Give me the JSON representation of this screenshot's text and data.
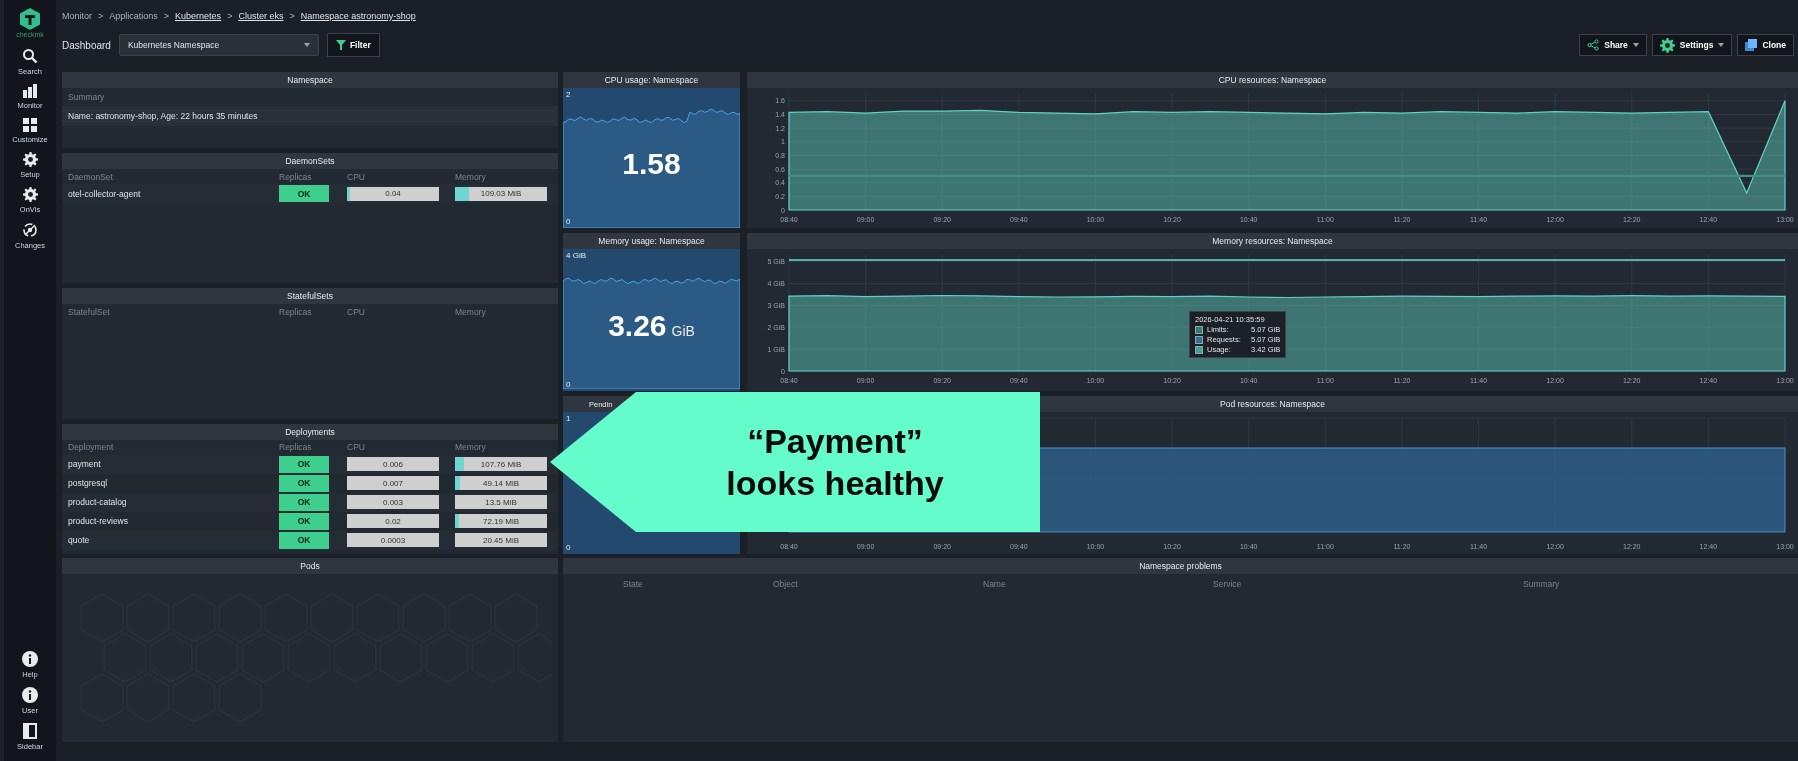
{
  "sidebar": {
    "logo_text": "checkmk",
    "items": [
      {
        "label": "Search",
        "kind": "search"
      },
      {
        "label": "Monitor",
        "kind": "bars"
      },
      {
        "label": "Customize",
        "kind": "grid"
      },
      {
        "label": "Setup",
        "kind": "gear"
      },
      {
        "label": "OnVis",
        "kind": "gear"
      },
      {
        "label": "Changes",
        "kind": "orbit"
      }
    ],
    "bottom_items": [
      {
        "label": "Help",
        "kind": "info"
      },
      {
        "label": "User",
        "kind": "info"
      },
      {
        "label": "Sidebar",
        "kind": "panel"
      }
    ]
  },
  "breadcrumb": {
    "separator": ">",
    "items": [
      {
        "label": "Monitor",
        "link": false
      },
      {
        "label": "Applications",
        "link": false
      },
      {
        "label": "Kubernetes",
        "link": true
      },
      {
        "label": "Cluster eks",
        "link": true
      },
      {
        "label": "Namespace astronomy-shop",
        "link": true
      }
    ]
  },
  "dashboard": {
    "label": "Dashboard",
    "select_value": "Kubernetes Namespace",
    "filter": "Filter"
  },
  "actions": [
    {
      "label": "Share",
      "kind": "share",
      "dropdown": true
    },
    {
      "label": "Settings",
      "kind": "gear",
      "dropdown": true
    },
    {
      "label": "Clone",
      "kind": "clone",
      "dropdown": false
    }
  ],
  "namespace": {
    "title": "Namespace",
    "summary_header": "Summary",
    "summary": "Name: astronomy-shop, Age: 22 hours 35 minutes"
  },
  "daemonsets": {
    "title": "DaemonSets",
    "columns": [
      "DaemonSet",
      "Replicas",
      "CPU",
      "Memory"
    ],
    "rows": [
      {
        "name": "otel-collector-agent",
        "replicas": "OK",
        "cpu": {
          "value": "0.04",
          "level": 0.03
        },
        "memory": {
          "value": "109.03 MiB",
          "level": 0.15
        }
      }
    ]
  },
  "statefulsets": {
    "title": "StatefulSets",
    "columns": [
      "StatefulSet",
      "Replicas",
      "CPU",
      "Memory"
    ]
  },
  "deployments": {
    "title": "Deployments",
    "columns": [
      "Deployment",
      "Replicas",
      "CPU",
      "Memory"
    ],
    "rows": [
      {
        "name": "payment",
        "replicas": "OK",
        "cpu": {
          "value": "0.006"
        },
        "memory": {
          "value": "107.76 MiB",
          "level": 0.1
        }
      },
      {
        "name": "postgresql",
        "replicas": "OK",
        "cpu": {
          "value": "0.007"
        },
        "memory": {
          "value": "49.14 MiB",
          "level": 0.05
        }
      },
      {
        "name": "product-catalog",
        "replicas": "OK",
        "cpu": {
          "value": "0.003"
        },
        "memory": {
          "value": "13.5 MiB"
        }
      },
      {
        "name": "product-reviews",
        "replicas": "OK",
        "cpu": {
          "value": "0.02"
        },
        "memory": {
          "value": "72.19 MiB",
          "level": 0.04
        }
      },
      {
        "name": "quote",
        "replicas": "OK",
        "cpu": {
          "value": "0.0003"
        },
        "memory": {
          "value": "20.45 MiB"
        }
      }
    ]
  },
  "pods": {
    "title": "Pods"
  },
  "cpu_usage": {
    "title": "CPU usage: Namespace",
    "max_label": "2",
    "min_label": "0",
    "value": "1.58"
  },
  "cpu_resources": {
    "title": "CPU resources: Namespace",
    "chart_data": {
      "type": "area",
      "grid": true,
      "categories": [
        "08:40",
        null,
        "09:00",
        null,
        "09:20",
        null,
        "09:40",
        null,
        "10:00",
        null,
        "10:20",
        null,
        "10:40",
        null,
        "11:00",
        null,
        "11:20",
        null,
        "11:40",
        null,
        "12:00",
        null,
        "12:20",
        null,
        "12:40",
        null,
        "13:00"
      ],
      "series": [
        {
          "type": "area",
          "color": "#5fd3c2",
          "values": [
            1.43,
            1.44,
            1.42,
            1.45,
            1.45,
            1.46,
            1.43,
            1.42,
            1.41,
            1.44,
            1.43,
            1.44,
            1.43,
            1.42,
            1.41,
            1.43,
            1.42,
            1.44,
            1.43,
            1.42,
            1.44,
            1.43,
            1.42,
            1.43,
            1.44,
            0.25,
            1.6
          ]
        },
        {
          "type": "line",
          "color": "#3f8f86",
          "values": [
            0.5,
            0.5,
            0.5,
            0.5,
            0.5,
            0.5,
            0.5,
            0.5,
            0.5,
            0.5,
            0.5,
            0.5,
            0.5,
            0.5,
            0.5,
            0.5,
            0.5,
            0.5,
            0.5,
            0.5,
            0.5,
            0.5,
            0.5,
            0.5,
            0.5,
            0.5,
            0.5
          ]
        }
      ],
      "ylim": [
        0,
        1.7
      ],
      "yticks": [
        0,
        0.2,
        0.4,
        0.6,
        0.8,
        1,
        1.2,
        1.4,
        1.6
      ]
    }
  },
  "memory_usage": {
    "title": "Memory usage: Namespace",
    "max_label": "4 GiB",
    "min_label": "0",
    "value": "3.26",
    "unit": "GiB"
  },
  "memory_resources": {
    "title": "Memory resources: Namespace",
    "chart_data": {
      "type": "area",
      "grid": true,
      "categories": [
        "08:40",
        null,
        "09:00",
        null,
        "09:20",
        null,
        "09:40",
        null,
        "10:00",
        null,
        "10:20",
        null,
        "10:40",
        null,
        "11:00",
        null,
        "11:20",
        null,
        "11:40",
        null,
        "12:00",
        null,
        "12:20",
        null,
        "12:40",
        null,
        "13:00"
      ],
      "series": [
        {
          "type": "area",
          "color": "#5fd3c2",
          "values": [
            3.42,
            3.44,
            3.4,
            3.42,
            3.45,
            3.43,
            3.4,
            3.38,
            3.39,
            3.41,
            3.4,
            3.42,
            3.38,
            3.36,
            3.38,
            3.4,
            3.42,
            3.41,
            3.4,
            3.42,
            3.43,
            3.42,
            3.44,
            3.42,
            3.43,
            3.42,
            3.41
          ]
        },
        {
          "type": "line",
          "color": "#4fb3a6",
          "values": [
            5.07,
            5.07,
            5.07,
            5.07,
            5.07,
            5.07,
            5.07,
            5.07,
            5.07,
            5.07,
            5.07,
            5.07,
            5.07,
            5.07,
            5.07,
            5.07,
            5.07,
            5.07,
            5.07,
            5.07,
            5.07,
            5.07,
            5.07,
            5.07,
            5.07,
            5.07,
            5.07
          ]
        }
      ],
      "ylim": [
        0,
        5.3
      ],
      "yticks": [
        {
          "value": 0,
          "label": "0"
        },
        {
          "value": 1,
          "label": "1 GiB"
        },
        {
          "value": 2,
          "label": "2 GiB"
        },
        {
          "value": 3,
          "label": "3 GiB"
        },
        {
          "value": 4,
          "label": "4 GiB"
        },
        {
          "value": 5,
          "label": "5 GiB"
        }
      ]
    },
    "tooltip": {
      "time": "2026-04-21 10:35:59",
      "rows": [
        {
          "label": "Limits:",
          "value": "5.07 GiB",
          "color": "#2f7d6f"
        },
        {
          "label": "Requests:",
          "value": "5.07 GiB",
          "color": "#2f6f9c"
        },
        {
          "label": "Usage:",
          "value": "3.42 GiB",
          "color": "#3aa596"
        }
      ]
    }
  },
  "pending": {
    "title": "Pendin",
    "max_label": "1",
    "min_label": "0"
  },
  "pod_resources": {
    "title": "Pod resources: Namespace",
    "x_labels": [
      "08:40",
      "09:00",
      "09:20",
      "09:40",
      "10:00",
      "10:20",
      "10:40",
      "11:00",
      "11:20",
      "11:40",
      "12:00",
      "12:20",
      "12:40",
      "13:00"
    ]
  },
  "problems": {
    "title": "Namespace problems",
    "columns": [
      "State",
      "Object",
      "Name",
      "Service",
      "Summary"
    ]
  },
  "callout": {
    "lines": [
      "“Payment”",
      "looks healthy"
    ]
  }
}
